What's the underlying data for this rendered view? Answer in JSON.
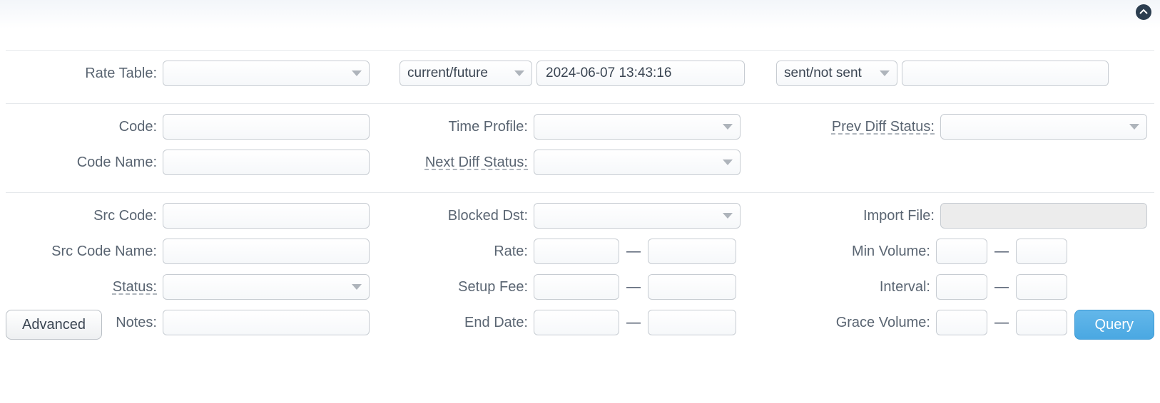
{
  "top": {
    "rate_table_label": "Rate Table:",
    "rate_table_value": "",
    "time_scope_value": "current/future",
    "datetime_value": "2024-06-07 13:43:16",
    "sent_filter_value": "sent/not sent",
    "sent_extra_value": ""
  },
  "sec2": {
    "code_label": "Code:",
    "code_value": "",
    "code_name_label": "Code Name:",
    "code_name_value": "",
    "time_profile_label": "Time Profile:",
    "time_profile_value": "",
    "next_diff_label": "Next Diff Status:",
    "next_diff_value": "",
    "prev_diff_label": "Prev Diff Status:",
    "prev_diff_value": ""
  },
  "sec3": {
    "src_code_label": "Src Code:",
    "src_code_value": "",
    "src_code_name_label": "Src Code Name:",
    "src_code_name_value": "",
    "status_label": "Status:",
    "status_value": "",
    "notes_label": "Notes:",
    "notes_value": "",
    "blocked_dst_label": "Blocked Dst:",
    "blocked_dst_value": "",
    "rate_label": "Rate:",
    "rate_from": "",
    "rate_to": "",
    "setup_fee_label": "Setup Fee:",
    "setup_fee_from": "",
    "setup_fee_to": "",
    "end_date_label": "End Date:",
    "end_date_from": "",
    "end_date_to": "",
    "import_file_label": "Import File:",
    "import_file_value": "",
    "min_volume_label": "Min Volume:",
    "min_volume_from": "",
    "min_volume_to": "",
    "interval_label": "Interval:",
    "interval_from": "",
    "interval_to": "",
    "grace_volume_label": "Grace Volume:",
    "grace_volume_from": "",
    "grace_volume_to": ""
  },
  "buttons": {
    "advanced": "Advanced",
    "query": "Query"
  },
  "dash": "—"
}
